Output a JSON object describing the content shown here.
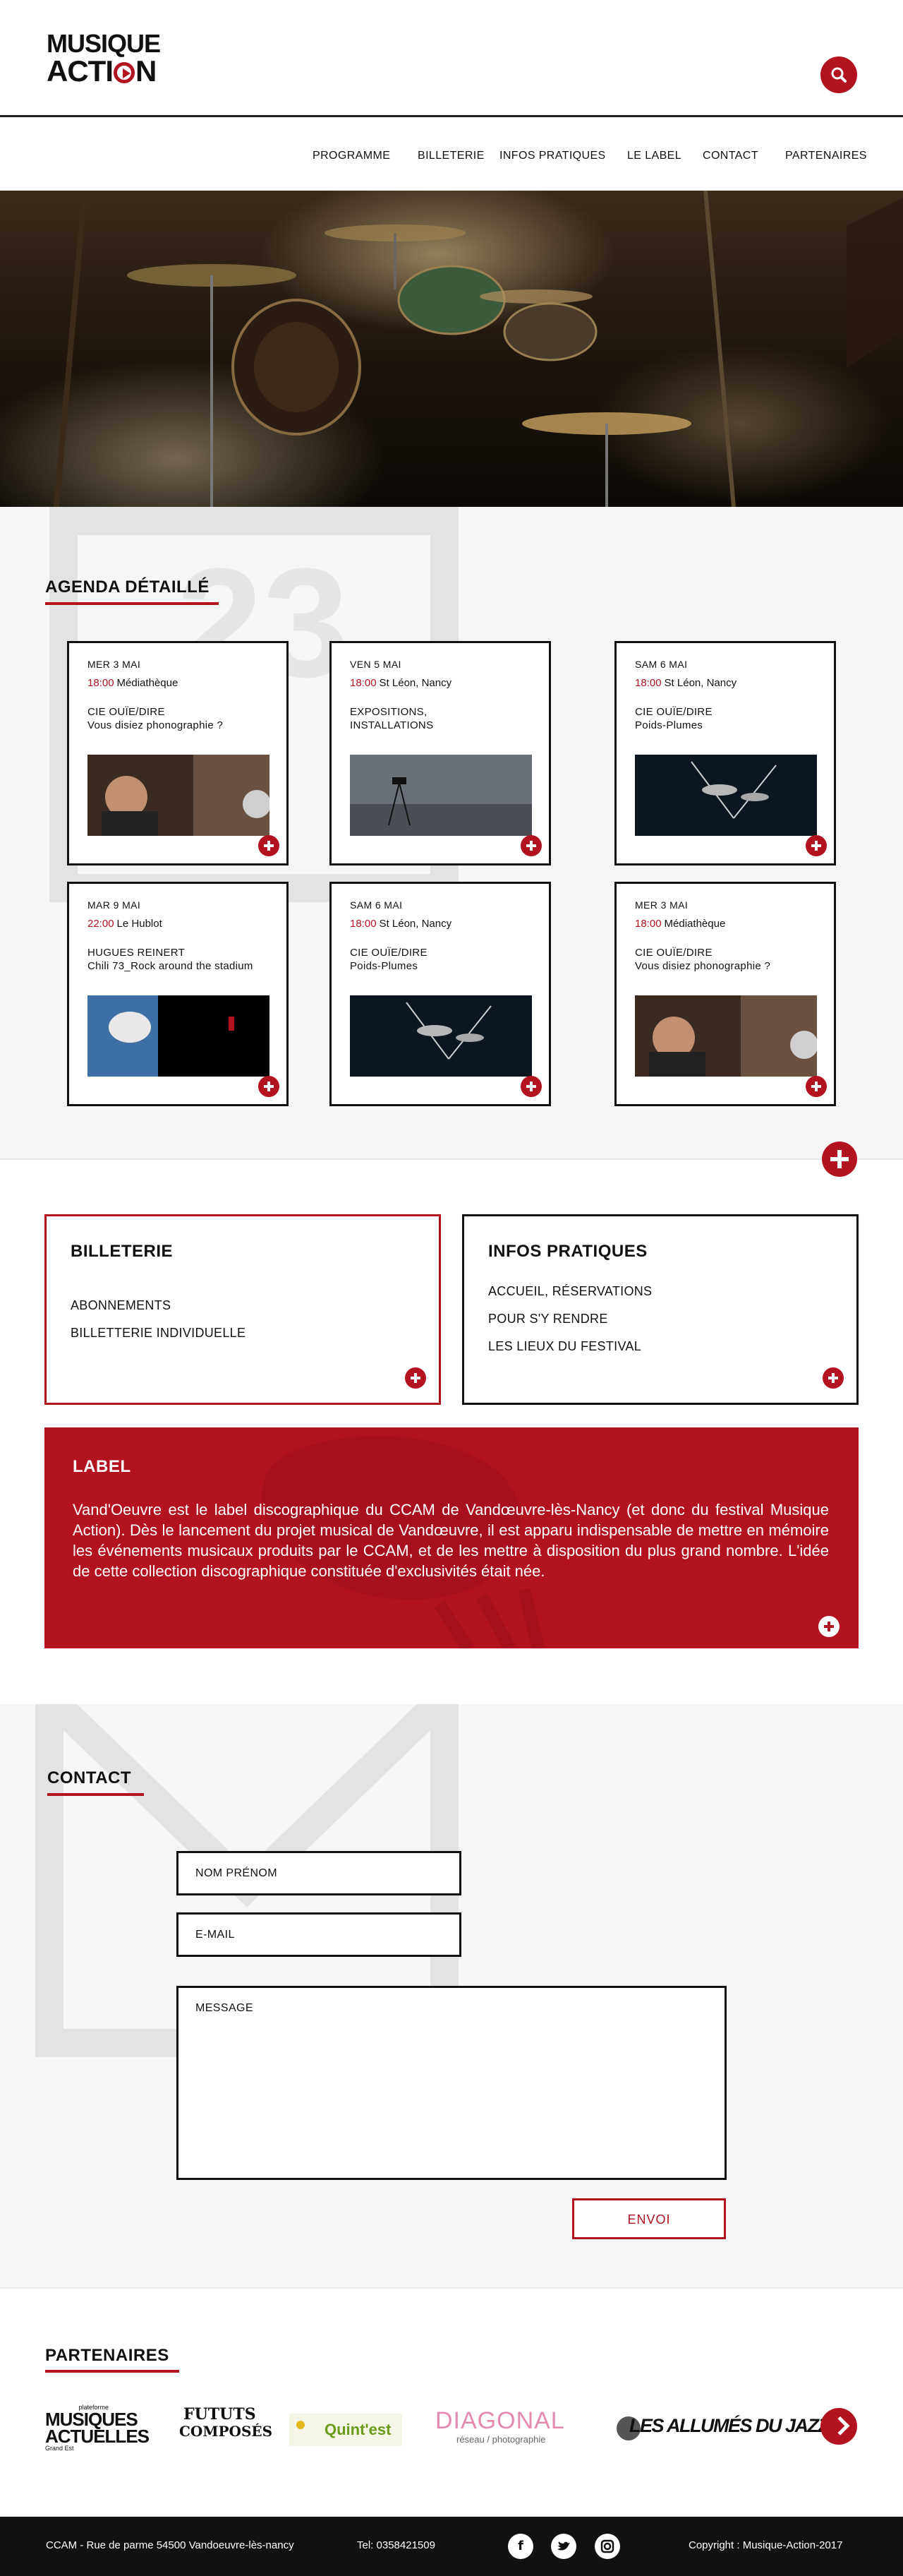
{
  "header": {
    "logo_line1": "MUSIQUE",
    "logo_line2_a": "ACTI",
    "logo_line2_b": "N"
  },
  "nav": {
    "items": [
      "PROGRAMME",
      "BILLETERIE",
      "INFOS PRATIQUES",
      "LE LABEL",
      "CONTACT",
      "PARTENAIRES"
    ]
  },
  "agenda": {
    "title": "AGENDA DÉTAILLÉ",
    "cards": [
      {
        "date": "MER 3 MAI",
        "time": "18:00",
        "place": "Médiathèque",
        "title_line1": "CIE OUÏE/DIRE",
        "title_line2": "Vous disiez phonographie ?"
      },
      {
        "date": "VEN 5 MAI",
        "time": "18:00",
        "place": "St Léon, Nancy",
        "title_line1": "EXPOSITIONS,",
        "title_line2": "INSTALLATIONS"
      },
      {
        "date": "SAM 6 MAI",
        "time": "18:00",
        "place": "St Léon, Nancy",
        "title_line1": "CIE OUÏE/DIRE",
        "title_line2": "Poids-Plumes"
      },
      {
        "date": "MAR 9 MAI",
        "time": "22:00",
        "place": "Le Hublot",
        "title_line1": "HUGUES REINERT",
        "title_line2": "Chili 73_Rock around the stadium"
      },
      {
        "date": "SAM 6 MAI",
        "time": "18:00",
        "place": "St Léon, Nancy",
        "title_line1": "CIE OUÏE/DIRE",
        "title_line2": "Poids-Plumes"
      },
      {
        "date": "MER 3 MAI",
        "time": "18:00",
        "place": "Médiathèque",
        "title_line1": "CIE OUÏE/DIRE",
        "title_line2": "Vous disiez phonographie ?"
      }
    ]
  },
  "billeterie": {
    "title": "BILLETERIE",
    "items": [
      "ABONNEMENTS",
      "BILLETTERIE INDIVIDUELLE"
    ]
  },
  "infos": {
    "title": "INFOS PRATIQUES",
    "items": [
      "ACCUEIL, RÉSERVATIONS",
      "POUR S'Y RENDRE",
      "LES LIEUX DU FESTIVAL"
    ]
  },
  "label": {
    "title": "LABEL",
    "text": "Vand'Oeuvre est le label discographique du CCAM de Vandœuvre-lès-Nancy (et donc du festival Musique Action). Dès le lancement du projet musical de Vandœuvre, il est apparu indispensable de mettre en mémoire les événements musicaux produits par le CCAM, et de les mettre à disposition du plus grand nombre. L'idée de cette collection discographique constituée d'exclusivités était née."
  },
  "contact": {
    "title": "CONTACT",
    "name_label": "NOM PRÉNOM",
    "email_label": "E-MAIL",
    "message_label": "MESSAGE",
    "send_label": "ENVOI"
  },
  "partners": {
    "title": "PARTENAIRES",
    "logos": {
      "musiques_small": "plateforme",
      "musiques_line1": "MUSIQUES",
      "musiques_line2": "ACTUELLES",
      "musiques_foot": "Grand Est",
      "futurs_line1": "FUTUTS",
      "futurs_line2": "COMPOSÉS",
      "quintest": "Quint'est",
      "diagonal": "DIAGONAL",
      "diagonal_sub": "réseau / photographie",
      "allumes": "LES ALLUMÉS DU JAZZ"
    }
  },
  "footer": {
    "address": "CCAM - Rue de parme 54500 Vandoeuvre-lès-nancy",
    "tel": "Tel: 0358421509",
    "copyright": "Copyright : Musique-Action-2017",
    "social": [
      "facebook-icon",
      "twitter-icon",
      "instagram-icon"
    ]
  },
  "colors": {
    "accent": "#b3121f",
    "text": "#111111",
    "section_bg": "#f6f6f6",
    "footer_bg": "#111111"
  }
}
